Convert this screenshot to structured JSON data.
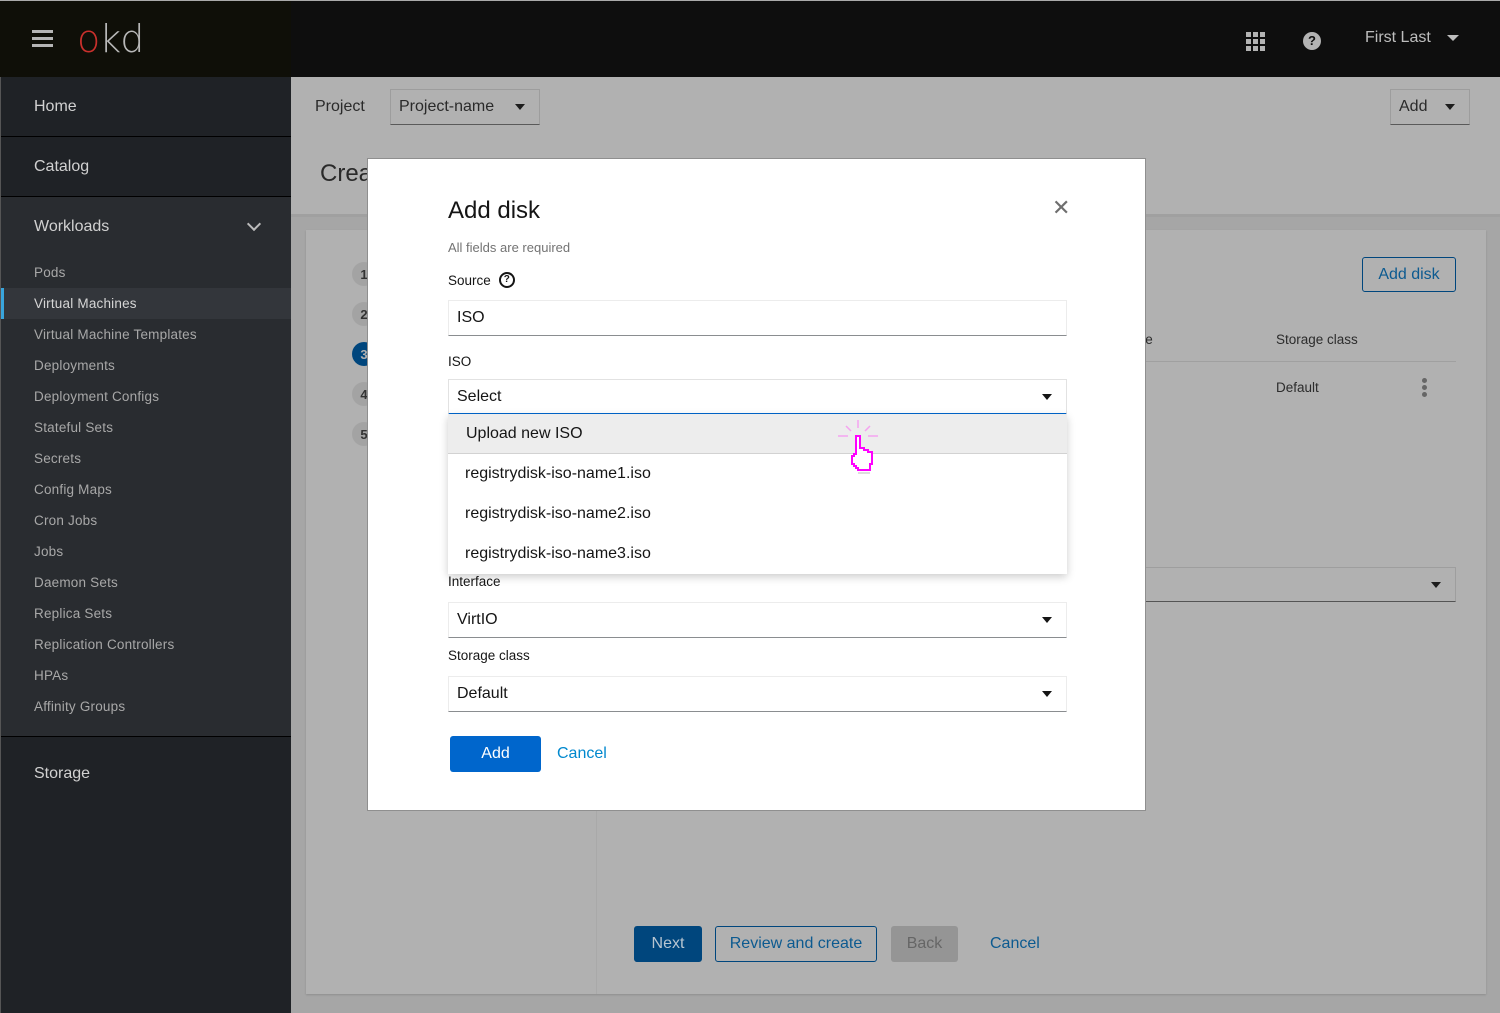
{
  "topbar": {
    "brand_o": "o",
    "brand_kd": "kd",
    "user_name": "First Last",
    "icons": [
      "hamburger-menu-icon",
      "app-launcher-grid-icon",
      "help-icon",
      "caret-down-icon"
    ]
  },
  "sidebar": {
    "home": "Home",
    "catalog": "Catalog",
    "workloads": {
      "label": "Workloads",
      "expanded": true,
      "items": [
        {
          "label": "Pods",
          "active": false
        },
        {
          "label": "Virtual Machines",
          "active": true
        },
        {
          "label": "Virtual Machine Templates",
          "active": false
        },
        {
          "label": "Deployments",
          "active": false
        },
        {
          "label": "Deployment Configs",
          "active": false
        },
        {
          "label": "Stateful Sets",
          "active": false
        },
        {
          "label": "Secrets",
          "active": false
        },
        {
          "label": "Config Maps",
          "active": false
        },
        {
          "label": "Cron Jobs",
          "active": false
        },
        {
          "label": "Jobs",
          "active": false
        },
        {
          "label": "Daemon Sets",
          "active": false
        },
        {
          "label": "Replica Sets",
          "active": false
        },
        {
          "label": "Replication Controllers",
          "active": false
        },
        {
          "label": "HPAs",
          "active": false
        },
        {
          "label": "Affinity Groups",
          "active": false
        }
      ]
    },
    "storage": "Storage"
  },
  "project_bar": {
    "label": "Project",
    "selected": "Project-name",
    "add_label": "Add"
  },
  "page": {
    "title_partial": "Crea"
  },
  "wizard": {
    "steps": [
      "1",
      "2",
      "3",
      "4",
      "5"
    ],
    "current_step": 3,
    "add_disk_label": "Add disk",
    "table": {
      "headers": [
        "ace",
        "Storage class"
      ],
      "rows": [
        {
          "storage_class": "Default"
        }
      ]
    },
    "footer": {
      "next": "Next",
      "review": "Review and create",
      "back": "Back",
      "cancel": "Cancel"
    }
  },
  "modal": {
    "title": "Add disk",
    "required_note": "All fields are required",
    "source": {
      "label": "Source",
      "value": "ISO"
    },
    "iso": {
      "label": "ISO",
      "placeholder": "Select",
      "open": true,
      "options": [
        "Upload new ISO",
        "registrydisk-iso-name1.iso",
        "registrydisk-iso-name2.iso",
        "registrydisk-iso-name3.iso"
      ],
      "hovered_option": "Upload new ISO"
    },
    "interface": {
      "label": "Interface",
      "value": "VirtIO"
    },
    "storage_class": {
      "label": "Storage class",
      "value": "Default"
    },
    "add_button": "Add",
    "cancel_button": "Cancel"
  },
  "colors": {
    "primary": "#0066cc",
    "link": "#0088ce",
    "active_nav_border": "#39a5dc",
    "brand_red": "#c9302c",
    "cursor": "#ff00ff"
  }
}
